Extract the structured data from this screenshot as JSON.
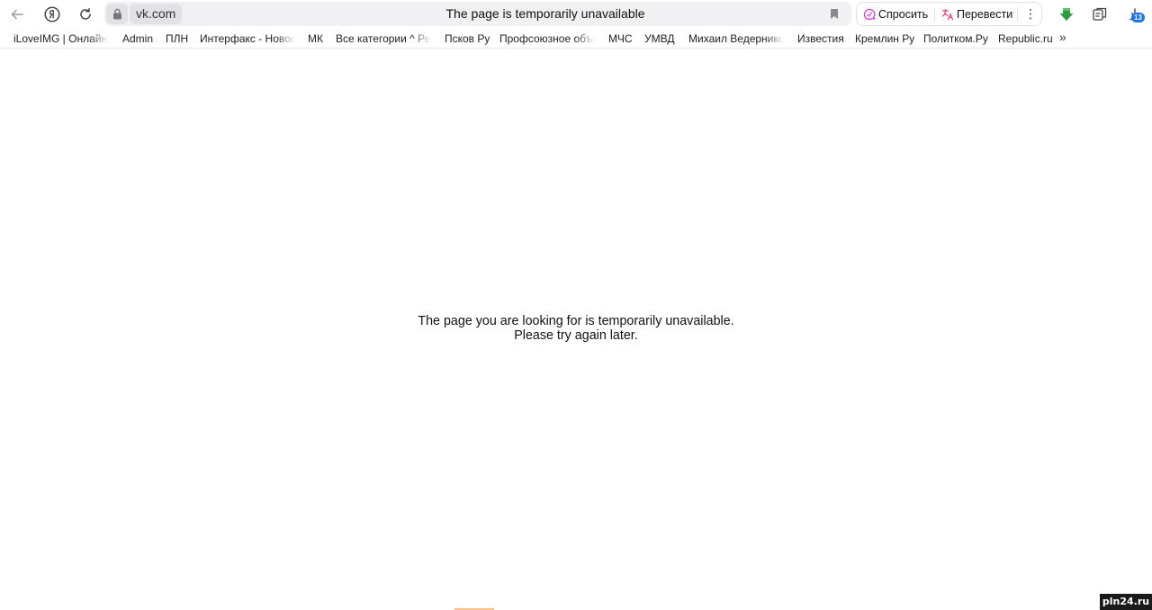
{
  "toolbar": {
    "back_icon": "arrow-left-icon",
    "yandex_icon": "yandex-logo-icon",
    "reload_icon": "reload-icon",
    "domain": "vk.com",
    "page_title": "The page is temporarily unavailable",
    "ask_label": "Спросить",
    "translate_label": "Перевести",
    "more_label": "⋮",
    "download_badge": "13"
  },
  "bookmarks": {
    "items": [
      "iLoveIMG | Онлайн и",
      "Admin",
      "ПЛН",
      "Интерфакс - Новост",
      "МК",
      "Все категории ^ Рей",
      "Псков Ру",
      "Профсоюзное объед",
      "МЧС",
      "УМВД",
      "Михаил Ведерников",
      "Известия",
      "Кремлин Ру",
      "Политком.Ру",
      "Republic.ru"
    ],
    "more_label": "»"
  },
  "content": {
    "line1": "The page you are looking for is temporarily unavailable.",
    "line2": "Please try again later."
  },
  "watermark": "pln24.ru",
  "colors": {
    "omnibox_bg": "#f1f1f3",
    "ask_icon": "#d63ad6",
    "translate_icon": "#e0457b",
    "extension_green": "#2e9b3c",
    "badge_blue": "#1a73e8"
  }
}
